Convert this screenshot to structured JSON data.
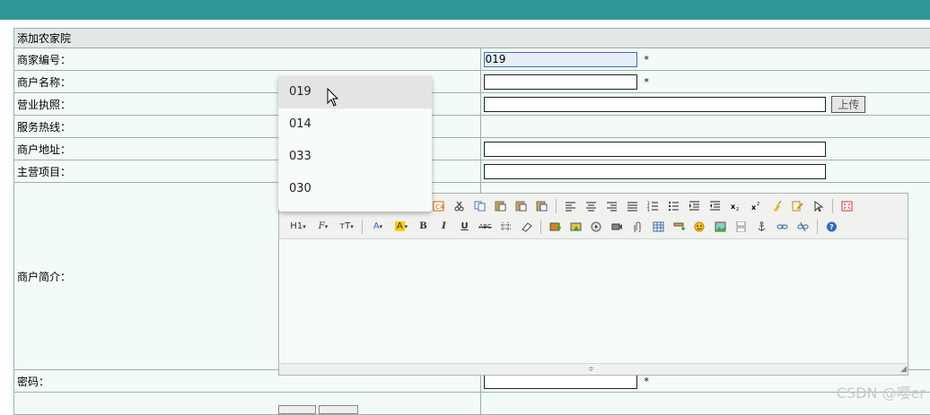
{
  "page": {
    "section_title": "添加农家院",
    "watermark": "CSDN @嘤er"
  },
  "form": {
    "merchant_id": {
      "label": "商家编号：",
      "value": "019",
      "required": "*"
    },
    "merchant_name": {
      "label": "商户名称：",
      "value": "",
      "required": "*"
    },
    "license": {
      "label": "营业执照：",
      "value": "",
      "upload_label": "上传"
    },
    "hotline": {
      "label": "服务热线："
    },
    "address": {
      "label": "商户地址：",
      "value": ""
    },
    "main_items": {
      "label": "主营项目：",
      "value": ""
    },
    "intro": {
      "label": "商户简介："
    },
    "password": {
      "label": "密码：",
      "value": "",
      "required": "*"
    }
  },
  "dropdown": {
    "options": [
      "019",
      "014",
      "033",
      "030"
    ],
    "highlighted": "019"
  },
  "editor": {
    "toolbar_row2_text": {
      "heading": "H1",
      "font_family": "F",
      "font_size": "тT",
      "font_color": "A",
      "bg_color": "A",
      "bold": "B",
      "italic": "I",
      "underline": "U",
      "strike": "ABC"
    },
    "colors": {
      "font_color": "#3366cc",
      "bg_color": "#ffcc00"
    }
  },
  "colors": {
    "topbar": "#2e9696",
    "cell_bg": "#f3fbf7",
    "header_bg": "#e4e8e6",
    "border": "#9ab3a8"
  }
}
